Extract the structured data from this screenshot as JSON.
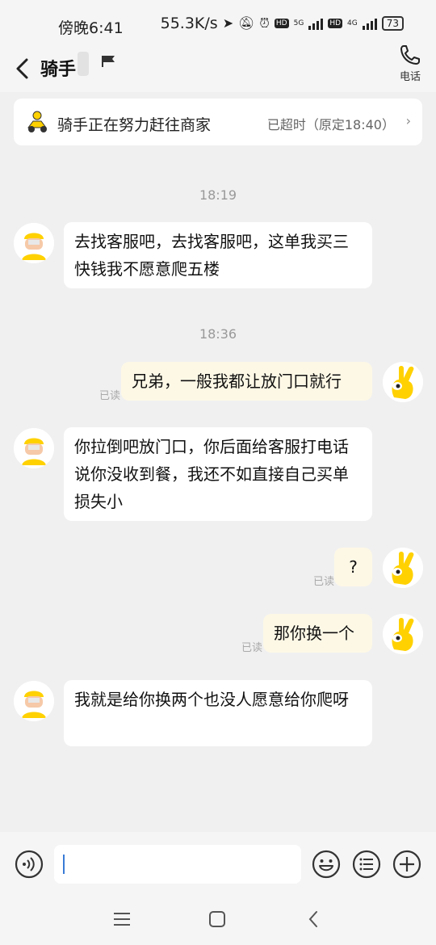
{
  "status_bar": {
    "time": "傍晚6:41",
    "network_speed": "55.3K/s",
    "battery": "73",
    "net1": "5G",
    "net2": "4G",
    "hd": "HD"
  },
  "header": {
    "title": "骑手",
    "phone_label": "电话"
  },
  "order_status": {
    "text": "骑手正在努力赶往商家",
    "right": "已超时（原定18:40）"
  },
  "timestamps": [
    "18:19",
    "18:36"
  ],
  "messages": [
    {
      "side": "left",
      "text": "去找客服吧，去找客服吧，这单我买三快钱我不愿意爬五楼"
    },
    {
      "side": "right",
      "text": "兄弟，一般我都让放门口就行",
      "status": "已读"
    },
    {
      "side": "left",
      "text": "你拉倒吧放门口，你后面给客服打电话说你没收到餐，我还不如直接自己买单损失小"
    },
    {
      "side": "right",
      "text": "?",
      "status": "已读"
    },
    {
      "side": "right",
      "text": "那你换一个",
      "status": "已读"
    },
    {
      "side": "left",
      "text": "我就是给你换两个也没人愿意给你爬呀"
    }
  ],
  "input": {
    "value": "",
    "placeholder": ""
  },
  "colors": {
    "brand_yellow": "#ffd100",
    "right_bubble": "#fdf8e6",
    "caret": "#3a7bd5"
  }
}
